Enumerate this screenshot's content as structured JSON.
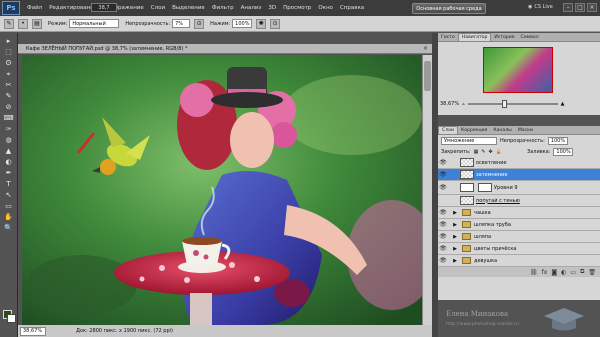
{
  "app": {
    "logo": "Ps",
    "menu": [
      "Файл",
      "Редактирование",
      "Изображение",
      "Слои",
      "Выделение",
      "Фильтр",
      "Анализ",
      "3D",
      "Просмотр",
      "Окно",
      "Справка"
    ],
    "zoom_combo": "38,7",
    "workspace_button": "Основная рабочая среда",
    "cs_live": "CS Live",
    "window_controls": [
      "–",
      "□",
      "×"
    ]
  },
  "options_bar": {
    "mode_label": "Режим:",
    "mode_value": "Нормальный",
    "opacity_label": "Непрозрачность:",
    "opacity_value": "7%",
    "pressure_label": "Нажим:",
    "pressure_value": "100%"
  },
  "toolbar": {
    "tools": [
      "▸",
      "⬚",
      "ʘ",
      "⌖",
      "✂",
      "✎",
      "⊘",
      "⌨",
      "✑",
      "◍",
      "▲",
      "◐",
      "✒",
      "T",
      "↖",
      "▭",
      "✋",
      "🔍"
    ]
  },
  "document": {
    "tab_title": "Кафе ЗЕЛЁНЫЙ ПОПУГАЙ.psd @ 38,7% (затемнение, RGB/8) *",
    "status_zoom": "38,67%",
    "status_info": "Док: 2800 пикс. x 1900 пикс. (72 ppi)"
  },
  "navigator": {
    "tabs": [
      "Гисто",
      "Навигатор",
      "История",
      "Символ"
    ],
    "active_tab": "Навигатор",
    "zoom": "38,67%"
  },
  "layers_panel": {
    "tabs": [
      "Слои",
      "Коррекция",
      "Каналы",
      "Маски"
    ],
    "blend_mode": "Умножение",
    "opacity_label": "Непрозрачность:",
    "opacity_value": "100%",
    "lock_label": "Закрепить:",
    "fill_label": "Заливка:",
    "fill_value": "100%",
    "layers": [
      {
        "name": "осветление",
        "kind": "pixel",
        "visible": true,
        "selected": false
      },
      {
        "name": "затемнение",
        "kind": "pixel",
        "visible": true,
        "selected": true
      },
      {
        "name": "Уровни 9",
        "kind": "adjustment",
        "visible": true,
        "selected": false
      },
      {
        "name": "попугай с тенью",
        "kind": "pixel",
        "visible": false,
        "selected": false
      },
      {
        "name": "чашка",
        "kind": "folder",
        "visible": true,
        "selected": false
      },
      {
        "name": "шляпка труба",
        "kind": "folder",
        "visible": true,
        "selected": false
      },
      {
        "name": "шляпа",
        "kind": "folder",
        "visible": true,
        "selected": false
      },
      {
        "name": "цветы причёска",
        "kind": "folder",
        "visible": true,
        "selected": false
      },
      {
        "name": "девушка",
        "kind": "folder",
        "visible": true,
        "selected": false
      }
    ]
  },
  "watermark": {
    "name": "Елена Минакова",
    "url": "http://www.photoshop-master.ru"
  },
  "colors": {
    "foreground": "#2d4d12",
    "background": "#ffffff",
    "selection": "#3d82d8"
  }
}
